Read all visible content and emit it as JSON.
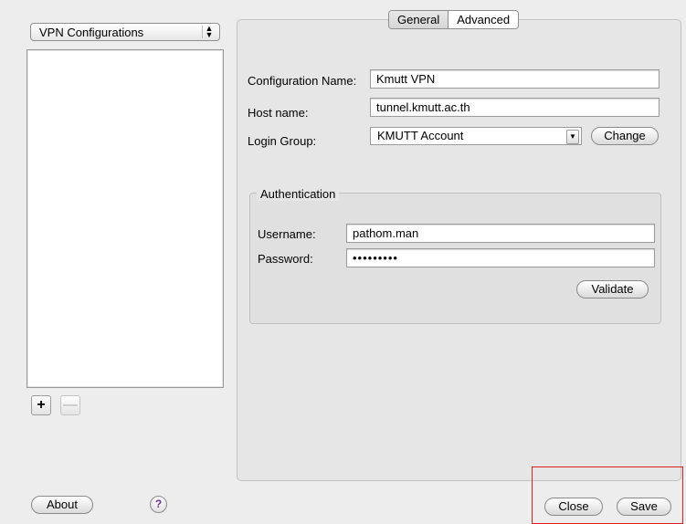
{
  "sidebar": {
    "popup_label": "VPN Configurations",
    "add_label": "+",
    "remove_label": "—"
  },
  "tabs": [
    {
      "label": "General"
    },
    {
      "label": "Advanced"
    }
  ],
  "form": {
    "config_name_label": "Configuration Name:",
    "config_name_value": "Kmutt VPN",
    "host_label": "Host name:",
    "host_value": "tunnel.kmutt.ac.th",
    "login_group_label": "Login Group:",
    "login_group_value": "KMUTT Account",
    "change_label": "Change"
  },
  "auth": {
    "title": "Authentication",
    "username_label": "Username:",
    "username_value": "pathom.man",
    "password_label": "Password:",
    "password_value": "•••••••••",
    "validate_label": "Validate"
  },
  "footer": {
    "about_label": "About",
    "help_label": "?",
    "close_label": "Close",
    "save_label": "Save"
  },
  "colors": {
    "highlight_box": "#e0201a"
  }
}
